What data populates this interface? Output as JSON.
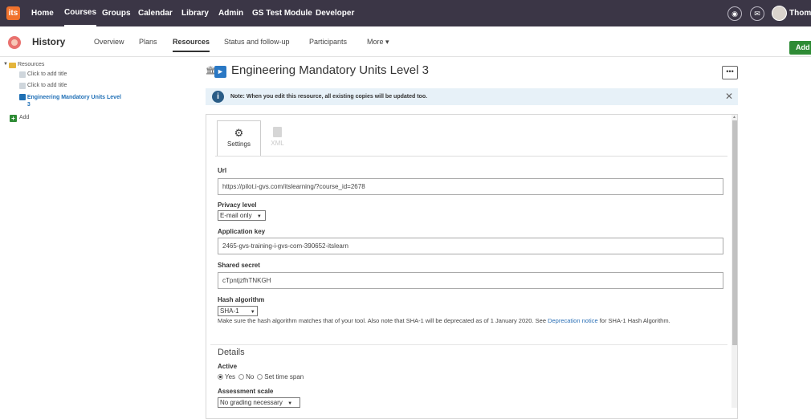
{
  "topnav": {
    "logo": "its",
    "items": [
      "Home",
      "Courses",
      "Groups",
      "Calendar",
      "Library",
      "Admin",
      "GS Test Module",
      "Developer"
    ],
    "active": "Courses",
    "username": "Thoma"
  },
  "subnav": {
    "course_title": "History",
    "items": [
      "Overview",
      "Plans",
      "Resources",
      "Status and follow-up",
      "Participants",
      "More ▾"
    ],
    "active": "Resources",
    "add_label": "Add"
  },
  "tree": {
    "root": "Resources",
    "items": [
      "Click to add title",
      "Click to add title",
      "Engineering Mandatory Units Level 3"
    ],
    "add_label": "Add"
  },
  "resource": {
    "title": "Engineering Mandatory Units Level 3",
    "more_label": "•••",
    "notice": "Note: When you edit this resource, all existing copies will be updated too."
  },
  "tabs": {
    "settings": "Settings",
    "xml": "XML"
  },
  "form": {
    "url_label": "Url",
    "url_value": "https://pilot.i-gvs.com/itslearning/?course_id=2678",
    "privacy_label": "Privacy level",
    "privacy_value": "E-mail only",
    "appkey_label": "Application key",
    "appkey_value": "2465-gvs-training-i-gvs-com-390652-itslearn",
    "secret_label": "Shared secret",
    "secret_value": "cTpntjzfhTNKGH",
    "hash_label": "Hash algorithm",
    "hash_value": "SHA-1",
    "hash_help_1": "Make sure the hash algorithm matches that of your tool. Also note that SHA-1 will be deprecated as of 1 January 2020. See ",
    "hash_help_link": "Deprecation notice",
    "hash_help_2": " for SHA-1 Hash Algorithm.",
    "details_title": "Details",
    "active_label": "Active",
    "active_options": [
      "Yes",
      "No",
      "Set time span"
    ],
    "assessment_label": "Assessment scale",
    "assessment_value": "No grading necessary"
  }
}
